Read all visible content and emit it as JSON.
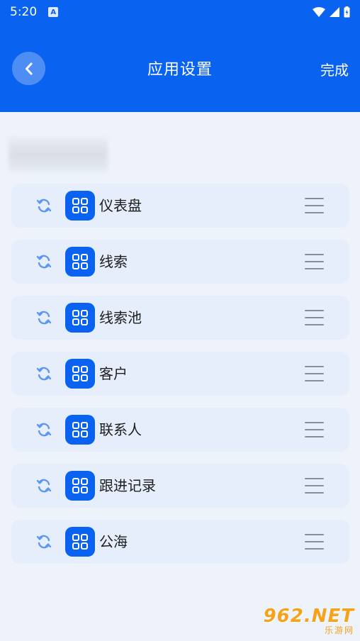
{
  "status_bar": {
    "time": "5:20",
    "notification_glyph": "A"
  },
  "header": {
    "title": "应用设置",
    "done_label": "完成"
  },
  "section": {
    "label": ""
  },
  "items": [
    {
      "label": "仪表盘"
    },
    {
      "label": "线索"
    },
    {
      "label": "线索池"
    },
    {
      "label": "客户"
    },
    {
      "label": "联系人"
    },
    {
      "label": "跟进记录"
    },
    {
      "label": "公海"
    }
  ],
  "watermark": {
    "main": "962.NET",
    "sub": "乐游网"
  },
  "colors": {
    "primary": "#0a63f0",
    "row_bg": "#e6eefc",
    "page_bg": "#eef3fb"
  }
}
